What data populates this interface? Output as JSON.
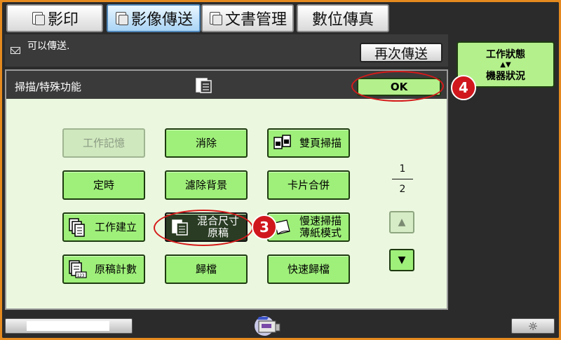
{
  "tabs": [
    {
      "label": "影印",
      "icon": "copy-icon"
    },
    {
      "label": "影像傳送",
      "icon": "image-send-icon"
    },
    {
      "label": "文書管理",
      "icon": "document-filing-icon"
    },
    {
      "label": "數位傳真",
      "icon": ""
    }
  ],
  "status": {
    "text": "可以傳送.",
    "resend_label": "再次傳送"
  },
  "job_status": {
    "line1": "工作狀態",
    "arrows": "▲▼",
    "line2": "機器狀況"
  },
  "panel": {
    "title": "掃描/特殊功能",
    "ok_label": "OK"
  },
  "buttons": {
    "job_memory": "工作記憶",
    "erase": "消除",
    "duplex_scan": "雙頁掃描",
    "timer": "定時",
    "suppress_bg": "濾除背景",
    "card_shot": "卡片合併",
    "job_build_up": "工作建立",
    "mixed_size_1": "混合尺寸",
    "mixed_size_2": "原稿",
    "slow_scan_1": "慢速掃描",
    "slow_scan_2": "薄紙模式",
    "original_count": "原稿計數",
    "file": "歸檔",
    "quick_file": "快速歸檔"
  },
  "pager": {
    "current": "1",
    "total": "2"
  },
  "annotations": {
    "step3": "3",
    "step4": "4"
  },
  "colors": {
    "accent_green": "#9ff07a",
    "selected_dark": "#2a3d24",
    "annotation_red": "#d0171d",
    "frame_orange": "#e58a1f"
  }
}
